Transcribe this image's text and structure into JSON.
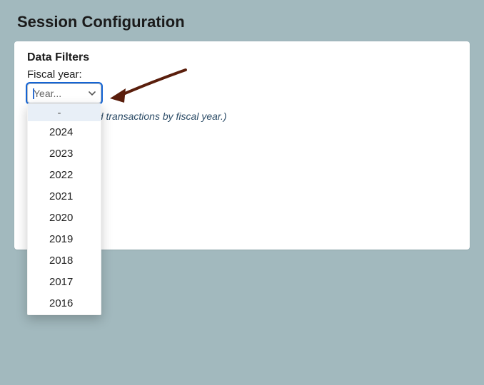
{
  "page": {
    "title": "Session Configuration"
  },
  "card": {
    "section_title": "Data Filters",
    "fiscal_year": {
      "label": "Fiscal year:",
      "placeholder": "Year...",
      "help_text": "(Filter orders and transactions by fiscal year.)",
      "options": [
        "-",
        "2024",
        "2023",
        "2022",
        "2021",
        "2020",
        "2019",
        "2018",
        "2017",
        "2016"
      ]
    }
  },
  "annotation": {
    "arrow_color": "#5a1e0c"
  }
}
